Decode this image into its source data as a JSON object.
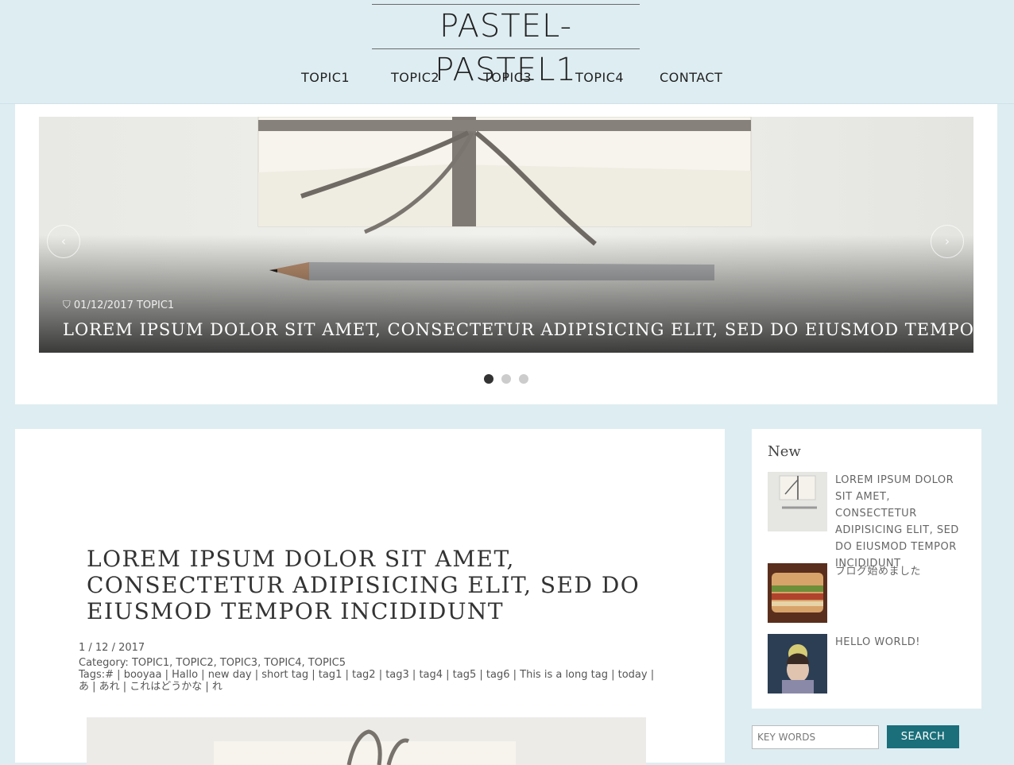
{
  "site": {
    "title": "PASTEL-PASTEL1"
  },
  "nav": [
    {
      "label": "TOPIC1"
    },
    {
      "label": "TOPIC2"
    },
    {
      "label": "TOPIC3"
    },
    {
      "label": "TOPIC4"
    },
    {
      "label": "CONTACT"
    }
  ],
  "slider": {
    "prev_label": "‹",
    "next_label": "›",
    "date": "01/12/2017",
    "topic": "TOPIC1",
    "title": "Lorem ipsum dolor sit amet, consectetur adipisicing elit, sed do eiusmod tempor incididunt",
    "slide_count": 3,
    "active_slide": 1
  },
  "post": {
    "title": "Lorem ipsum dolor sit amet, consectetur adipisicing elit, sed do eiusmod tempor incididunt",
    "date": "1 / 12 / 2017",
    "categories": "Category: TOPIC1, TOPIC2, TOPIC3, TOPIC4, TOPIC5",
    "tags": "Tags:# | booyaa | Hallo | new day | short tag | tag1 | tag2 | tag3 | tag4 | tag5 | tag6 | This is a long tag | today | あ | あれ | これはどうかな | れ"
  },
  "sidebar": {
    "heading": "New",
    "items": [
      {
        "text": "Lorem ipsum dolor sit amet, consectetur adipisicing elit, sed do eiusmod tempor incididunt"
      },
      {
        "text": "ブログ始めました"
      },
      {
        "text": "Hello world!"
      }
    ]
  },
  "search": {
    "placeholder": "KEY WORDS",
    "button_label": "SEARCH"
  },
  "colors": {
    "background": "#deedf2",
    "accent": "#1a6f7a"
  }
}
